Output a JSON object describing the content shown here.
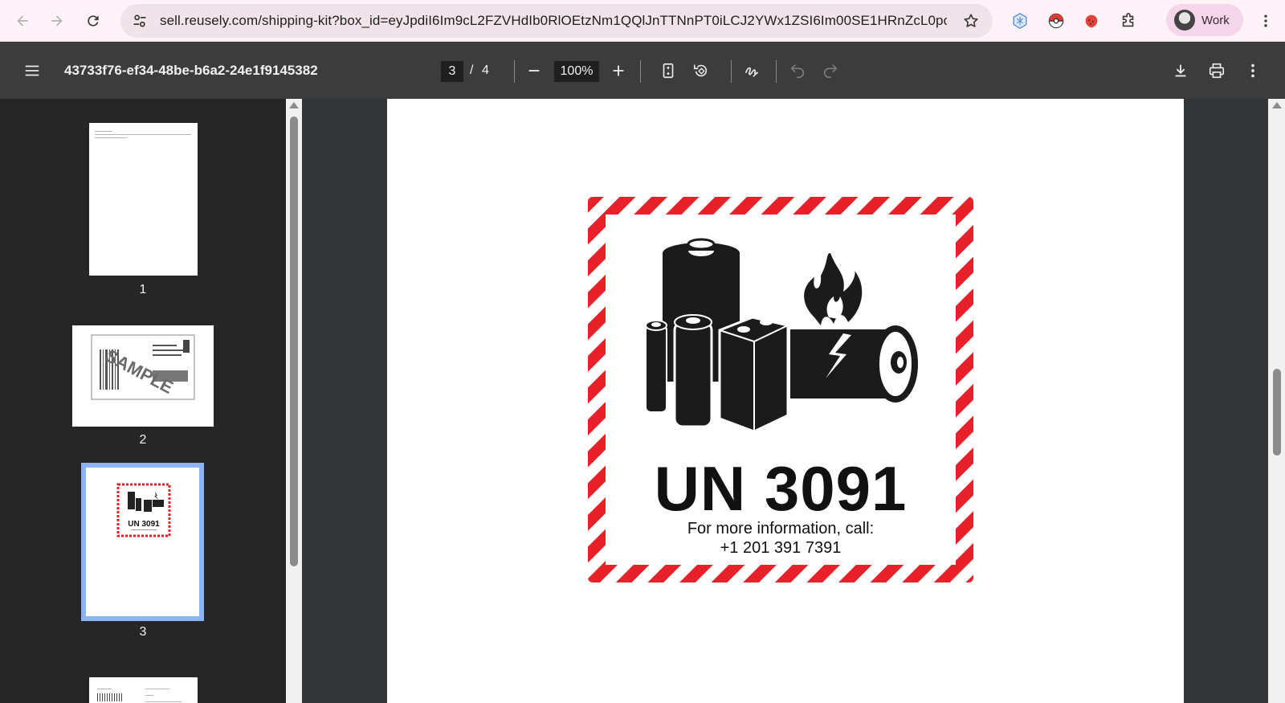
{
  "browser": {
    "url": "sell.reusely.com/shipping-kit?box_id=eyJpdiI6Im9cL2FZVHdIb0RlOEtzNm1QQlJnTTNnPT0iLCJ2YWx1ZSI6Im00SE1HRnZcL0pcL...",
    "profile_label": "Work"
  },
  "pdf": {
    "title": "43733f76-ef34-48be-b6a2-24e1f9145382",
    "current_page": "3",
    "page_separator": "/",
    "total_pages": "4",
    "zoom": "100%"
  },
  "thumbnails": [
    {
      "label": "1"
    },
    {
      "label": "2",
      "watermark": "SAMPLE"
    },
    {
      "label": "3",
      "mini_un": "UN 3091"
    }
  ],
  "label": {
    "un_number": "UN 3091",
    "info_line1": "For more information, call:",
    "info_line2": "+1 201 391 7391",
    "stripe_color": "#e8202a"
  },
  "icons": {
    "back": "arrow-left-icon",
    "forward": "arrow-right-icon",
    "reload": "reload-icon",
    "site_info": "tune-icon",
    "bookmark": "star-icon",
    "menu": "hamburger-icon",
    "zoom_out": "minus-icon",
    "zoom_in": "plus-icon",
    "fit": "fit-page-icon",
    "rotate": "rotate-icon",
    "annotate": "draw-icon",
    "undo": "undo-icon",
    "redo": "redo-icon",
    "download": "download-icon",
    "print": "print-icon",
    "more": "more-vert-icon"
  }
}
